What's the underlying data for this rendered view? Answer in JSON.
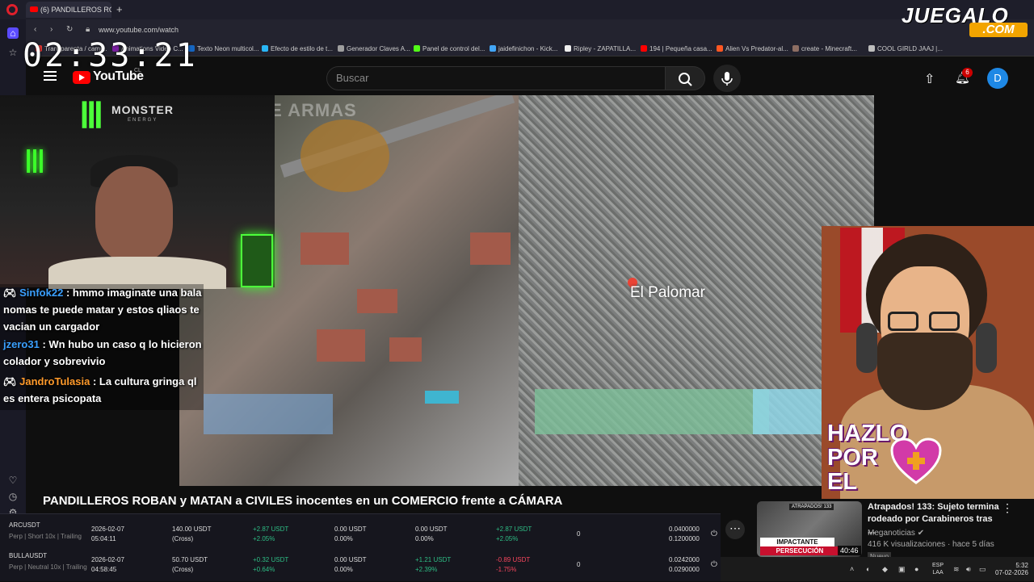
{
  "browser": {
    "tab_title": "(6) PANDILLEROS ROB",
    "url": "www.youtube.com/watch",
    "bookmarks": [
      "Transparenta / cami...",
      "Animations Video C...",
      "Texto Neon multicol...",
      "Efecto de estilo de t...",
      "Generador Claves A...",
      "Panel de control del...",
      "jaidefinichon - Kick...",
      "Ripley - ZAPATILLA...",
      "194 | Pequeña casa...",
      "Alien Vs Predator-al...",
      "create - Minecraft...",
      "COOL GIRLD JAAJ |..."
    ]
  },
  "overlay": {
    "timer": "02:33:21",
    "brand_logo": "JUEGALO",
    "brand_logo_domain": ".COM",
    "monster_text": "MONSTER",
    "monster_sub": "ENERGY",
    "hazlo_text": [
      "HAZLO",
      "POR",
      "EL"
    ]
  },
  "youtube": {
    "logo_text": "YouTube",
    "country_code": "CL",
    "search_placeholder": "Buscar",
    "notif_count": "6",
    "avatar_letter": "D",
    "video_title": "PANDILLEROS ROBAN y MATAN a CIVILES inocentes en un COMERCIO frente a CÁMARA",
    "video_map_label": "El Palomar",
    "video_watermark": "MUNDO DE ARMAS"
  },
  "chat": [
    {
      "user": "Sinfok22",
      "text": ": hmmo imaginate una bala nomas te puede matar y estos qliaos te vacian un cargador"
    },
    {
      "user": "jzero31",
      "text": ": Wn hubo un caso q lo hicieron colador y sobrevivio"
    },
    {
      "user": "JandroTulasia",
      "text": ": La cultura gringa ql es entera psicopata"
    }
  ],
  "trades": [
    {
      "symbol": "ARCUSDT",
      "sub": "Perp | Short 10x | Trailing",
      "date": "2026-02-07",
      "time": "05:04:11",
      "size": "140.00 USDT",
      "size_sub": "(Cross)",
      "pnl": "+2.87 USDT",
      "pnl_pct": "+2.05%",
      "c4": "0.00 USDT",
      "c4b": "0.00%",
      "c5": "0.00 USDT",
      "c5b": "0.00%",
      "c6": "+2.87 USDT",
      "c6b": "+2.05%",
      "qty": "0",
      "p1": "0.0400000",
      "p2": "0.1200000"
    },
    {
      "symbol": "BULLAUSDT",
      "sub": "Perp | Neutral 10x | Trailing",
      "date": "2026-02-07",
      "time": "04:58:45",
      "size": "50.70 USDT",
      "size_sub": "(Cross)",
      "pnl": "+0.32 USDT",
      "pnl_pct": "+0.64%",
      "c4": "0.00 USDT",
      "c4b": "0.00%",
      "c5": "+1.21 USDT",
      "c5b": "+2.39%",
      "c6": "-0.89 USDT",
      "c6b": "-1.75%",
      "qty": "0",
      "p1": "0.0242000",
      "p2": "0.0290000"
    }
  ],
  "recommended": {
    "title": "Atrapados! 133: Sujeto termina rodeado por Carabineros tras ...",
    "channel": "Meganoticias",
    "meta": "416 K visualizaciones · hace 5 días",
    "badge": "Nuevo",
    "duration": "40:46",
    "thumb_top": "ATRAPADOS! 133",
    "thumb_label1": "IMPACTANTE",
    "thumb_label2": "PERSECUCIÓN POLICIAL"
  },
  "taskbar": {
    "lang1": "ESP",
    "lang2": "LAA",
    "time": "5:32",
    "date": "07-02-2026"
  },
  "colors": {
    "accent_red": "#ff0000",
    "trade_positive": "#2ebd85",
    "trade_negative": "#f6465d",
    "avatar_blue": "#1e88e5",
    "monster_green": "#4cff3a"
  }
}
